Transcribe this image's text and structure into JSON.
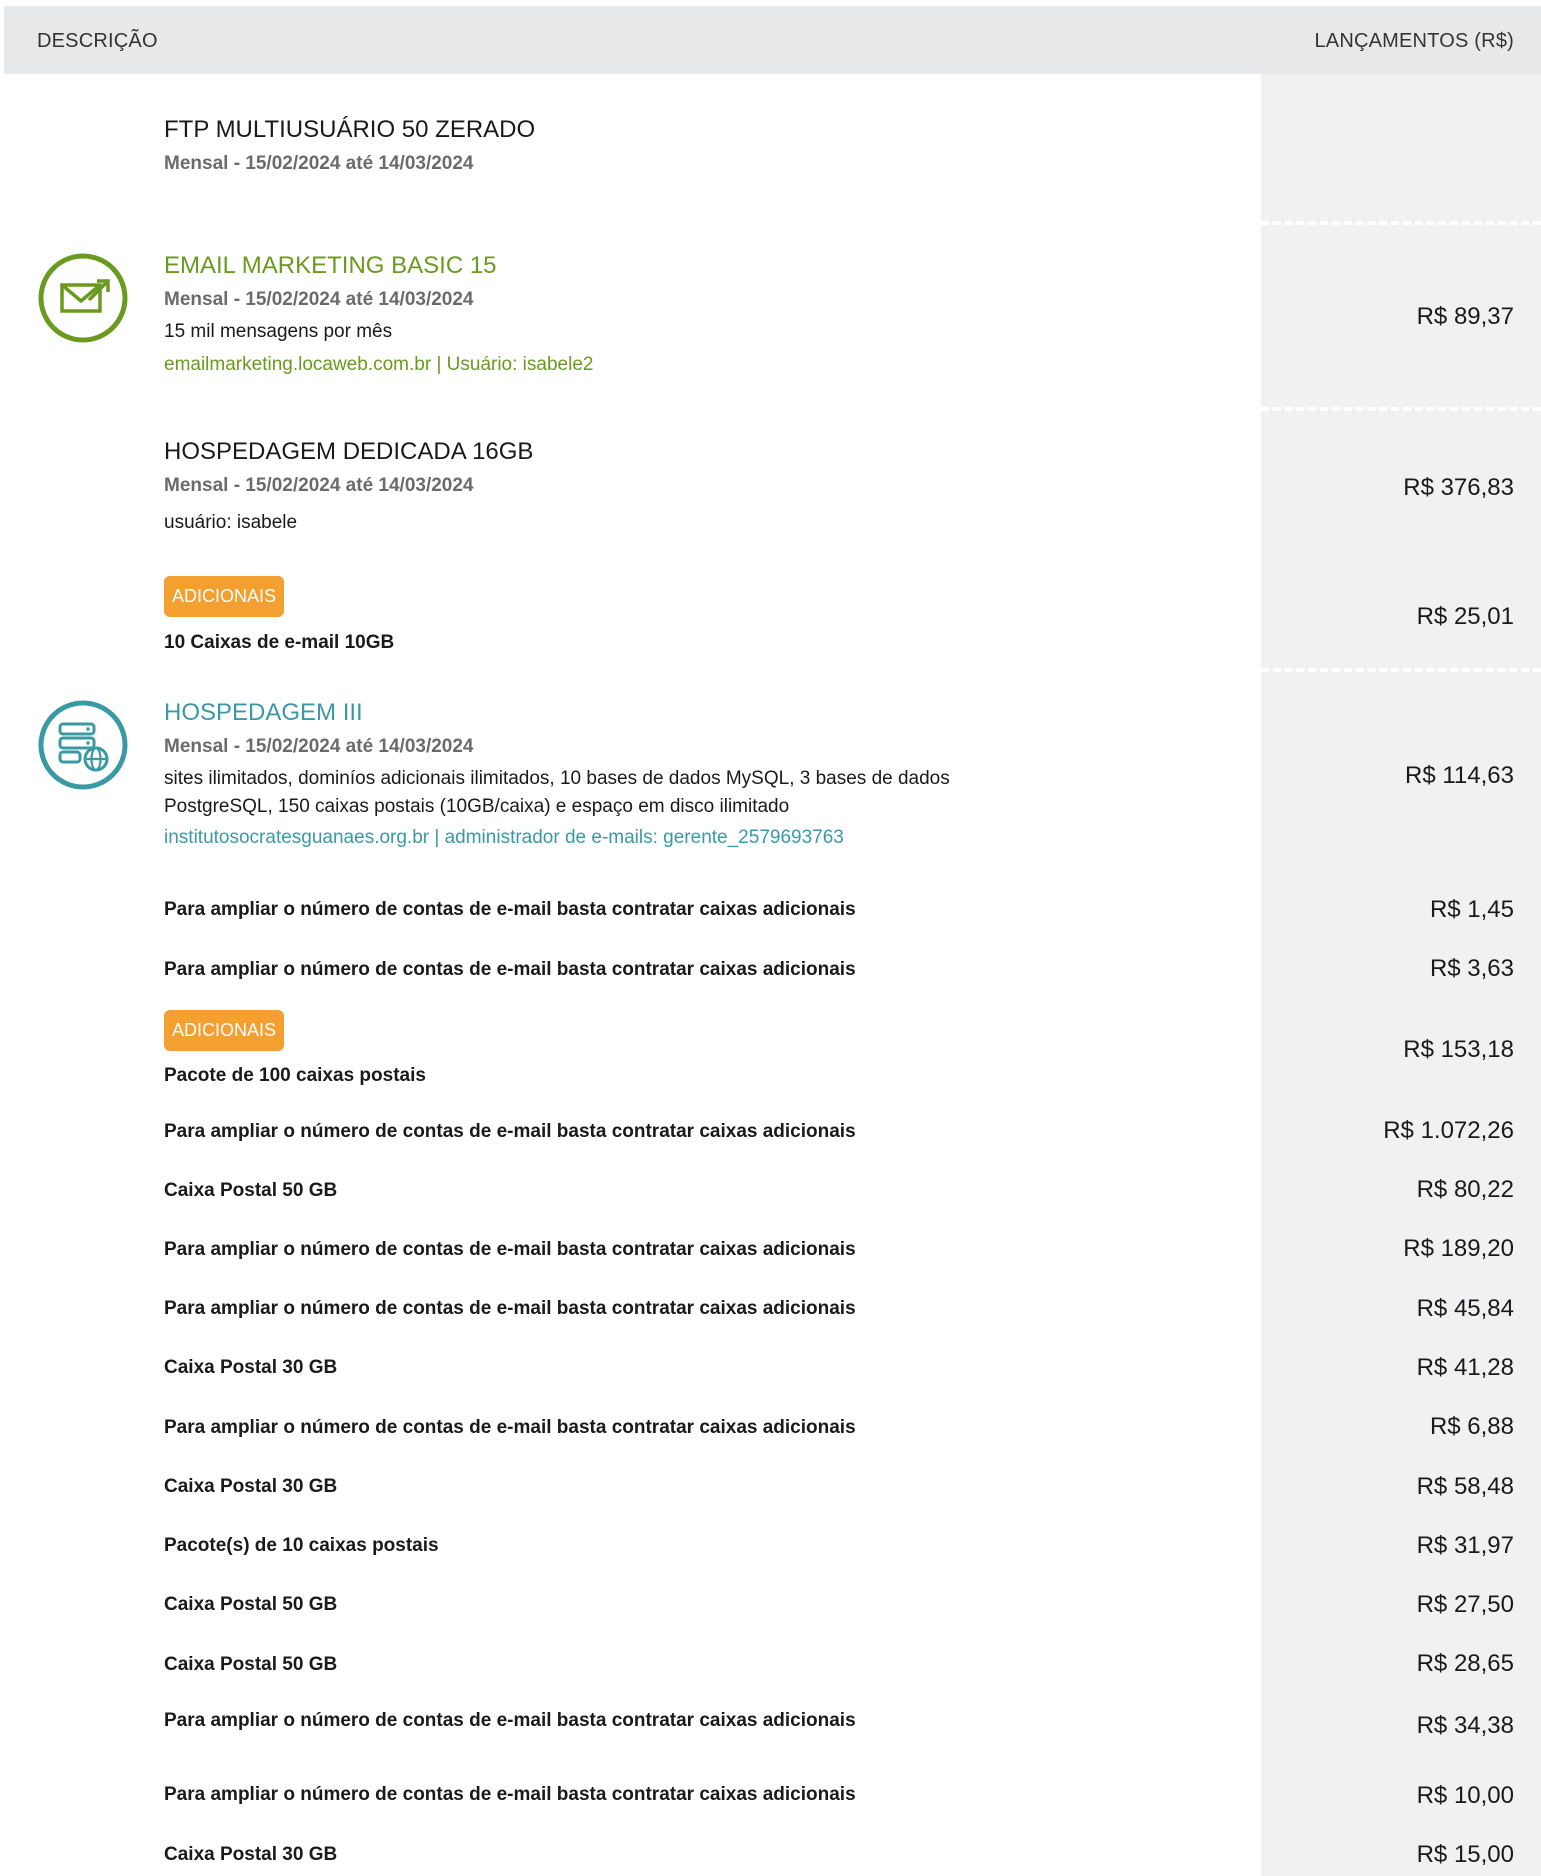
{
  "header": {
    "description_label": "DESCRIÇÃO",
    "amount_label": "LANÇAMENTOS (R$)"
  },
  "services": [
    {
      "title": "FTP MULTIUSUÁRIO 50 ZERADO",
      "period": "Mensal - 15/02/2024 até 14/03/2024"
    },
    {
      "title": "EMAIL MARKETING BASIC 15",
      "icon": "email-marketing-icon",
      "period": "Mensal - 15/02/2024 até 14/03/2024",
      "info": "15 mil mensagens por mês",
      "link": "emailmarketing.locaweb.com.br | Usuário: isabele2",
      "amount": "R$ 89,37",
      "accent": "#6a9a1f"
    },
    {
      "title": "HOSPEDAGEM DEDICADA 16GB",
      "period": "Mensal - 15/02/2024 até 14/03/2024",
      "info": "usuário: isabele",
      "amount": "R$ 376,83",
      "badge": "ADICIONAIS",
      "addons": [
        {
          "label": "10 Caixas de e-mail 10GB",
          "amount": "R$ 25,01"
        }
      ]
    },
    {
      "title": "HOSPEDAGEM III",
      "icon": "hosting-server-globe-icon",
      "period": "Mensal - 15/02/2024 até 14/03/2024",
      "info_line1": "sites ilimitados, dominíos adicionais ilimitados, 10 bases de dados MySQL, 3 bases de dados",
      "info_line2": "PostgreSQL, 150 caixas postais (10GB/caixa) e espaço em disco ilimitado",
      "link": "institutosocratesguanaes.org.br | administrador de e-mails: gerente_2579693763",
      "amount": "R$ 114,63",
      "accent": "#3a9aa3",
      "badge": "ADICIONAIS",
      "pre_items": [
        {
          "label": "Para ampliar o número de contas de e-mail basta contratar caixas adicionais",
          "amount": "R$ 1,45"
        },
        {
          "label": "Para ampliar o número de contas de e-mail basta contratar caixas adicionais",
          "amount": "R$ 3,63"
        }
      ],
      "addons": [
        {
          "label": "Pacote de 100 caixas postais",
          "amount": "R$ 153,18"
        },
        {
          "label": "Para ampliar o número de contas de e-mail basta contratar caixas adicionais",
          "amount": "R$ 1.072,26"
        },
        {
          "label": "Caixa Postal 50 GB",
          "amount": "R$ 80,22"
        },
        {
          "label": "Para ampliar o número de contas de e-mail basta contratar caixas adicionais",
          "amount": "R$ 189,20"
        },
        {
          "label": "Para ampliar o número de contas de e-mail basta contratar caixas adicionais",
          "amount": "R$ 45,84"
        },
        {
          "label": "Caixa Postal 30 GB",
          "amount": "R$ 41,28"
        },
        {
          "label": "Para ampliar o número de contas de e-mail basta contratar caixas adicionais",
          "amount": "R$ 6,88"
        },
        {
          "label": "Caixa Postal 30 GB",
          "amount": "R$ 58,48"
        },
        {
          "label": "Pacote(s) de 10 caixas postais",
          "amount": "R$ 31,97"
        },
        {
          "label": "Caixa Postal 50 GB",
          "amount": "R$ 27,50"
        },
        {
          "label": "Caixa Postal 50 GB",
          "amount": "R$ 28,65"
        },
        {
          "label": "Para ampliar o número de contas de e-mail basta contratar caixas adicionais",
          "amount": "R$ 34,38"
        },
        {
          "label": "Para ampliar o número de contas de e-mail basta contratar caixas adicionais",
          "amount": "R$ 10,00"
        },
        {
          "label": "Caixa Postal 30 GB",
          "amount": "R$ 15,00"
        }
      ]
    }
  ]
}
